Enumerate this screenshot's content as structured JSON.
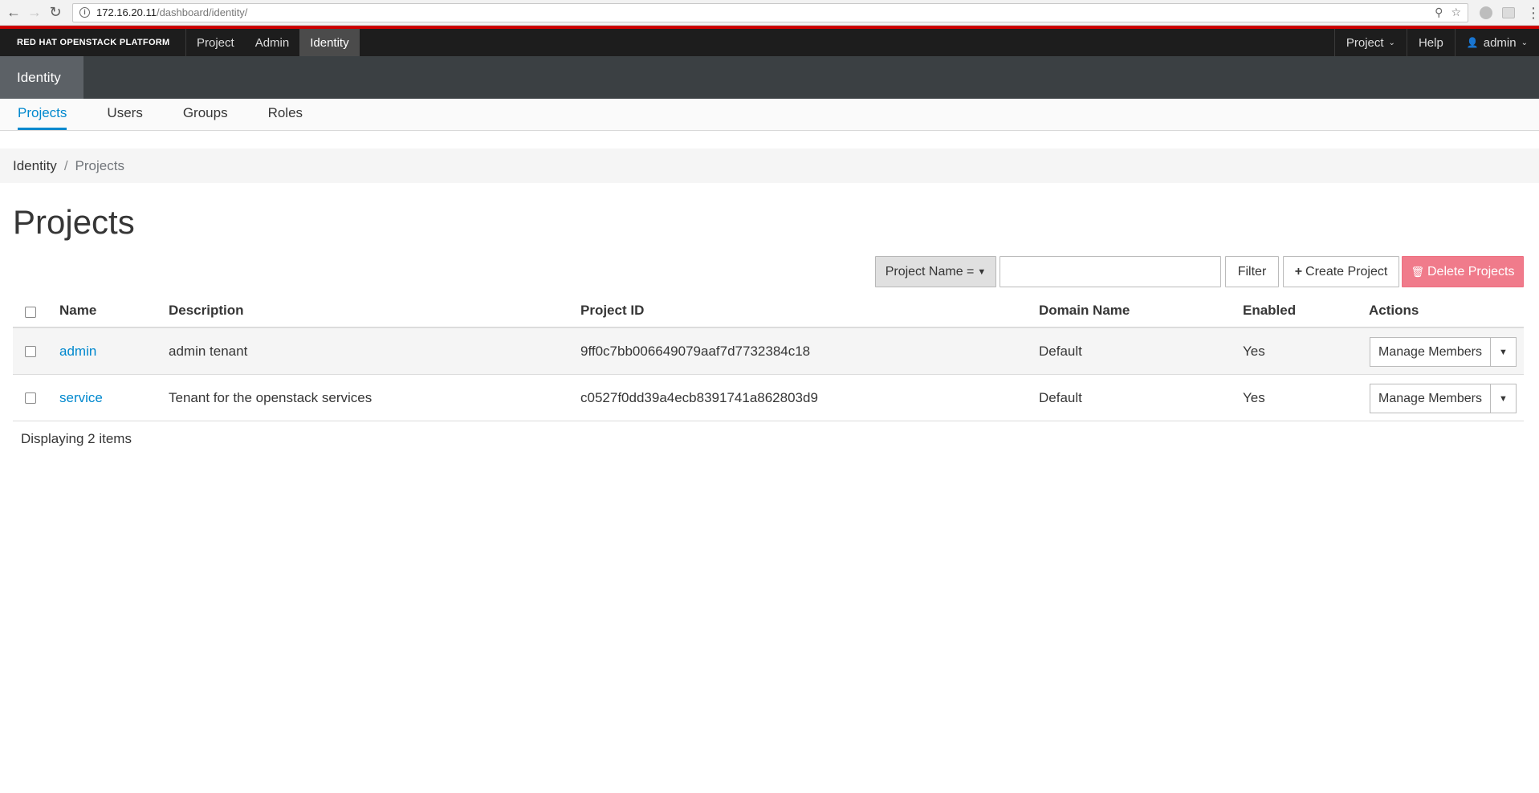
{
  "browser": {
    "url_host": "172.16.20.11",
    "url_path": "/dashboard/identity/"
  },
  "topnav": {
    "brand": "RED HAT OPENSTACK PLATFORM",
    "items": [
      {
        "label": "Project"
      },
      {
        "label": "Admin"
      },
      {
        "label": "Identity",
        "active": true
      }
    ],
    "right": {
      "project_menu": "Project",
      "help": "Help",
      "user": "admin"
    }
  },
  "secondary": {
    "active": "Identity"
  },
  "tabs": [
    {
      "label": "Projects",
      "active": true
    },
    {
      "label": "Users"
    },
    {
      "label": "Groups"
    },
    {
      "label": "Roles"
    }
  ],
  "breadcrumb": {
    "parent": "Identity",
    "separator": "/",
    "current": "Projects"
  },
  "page_title": "Projects",
  "toolbar": {
    "filter_field": "Project Name =",
    "filter_value": "",
    "filter_button": "Filter",
    "create_button": "Create Project",
    "delete_button": "Delete Projects"
  },
  "table": {
    "columns": [
      "Name",
      "Description",
      "Project ID",
      "Domain Name",
      "Enabled",
      "Actions"
    ],
    "rows": [
      {
        "name": "admin",
        "description": "admin tenant",
        "project_id": "9ff0c7bb006649079aaf7d7732384c18",
        "domain": "Default",
        "enabled": "Yes",
        "action": "Manage Members"
      },
      {
        "name": "service",
        "description": "Tenant for the openstack services",
        "project_id": "c0527f0dd39a4ecb8391741a862803d9",
        "domain": "Default",
        "enabled": "Yes",
        "action": "Manage Members"
      }
    ],
    "footer": "Displaying 2 items"
  },
  "colors": {
    "accent": "#0088ce",
    "brand_red": "#cc0000",
    "danger": "#f07b8b",
    "navbar": "#1d1d1d"
  }
}
